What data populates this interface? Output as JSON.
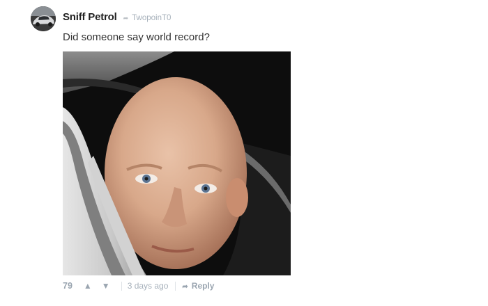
{
  "comment": {
    "author": "Sniff Petrol",
    "reply_icon": "reply-arrow-icon",
    "reply_to": "TwopoinT0",
    "text": "Did someone say world record?",
    "media": {
      "description_icon": "photo-image"
    },
    "footer": {
      "score": "79",
      "upvote_icon": "upvote-icon",
      "downvote_icon": "downvote-icon",
      "timestamp": "3 days ago",
      "reply_label": "Reply"
    }
  },
  "colors": {
    "author": "#222222",
    "muted": "#a7b1bb",
    "text": "#333333"
  }
}
